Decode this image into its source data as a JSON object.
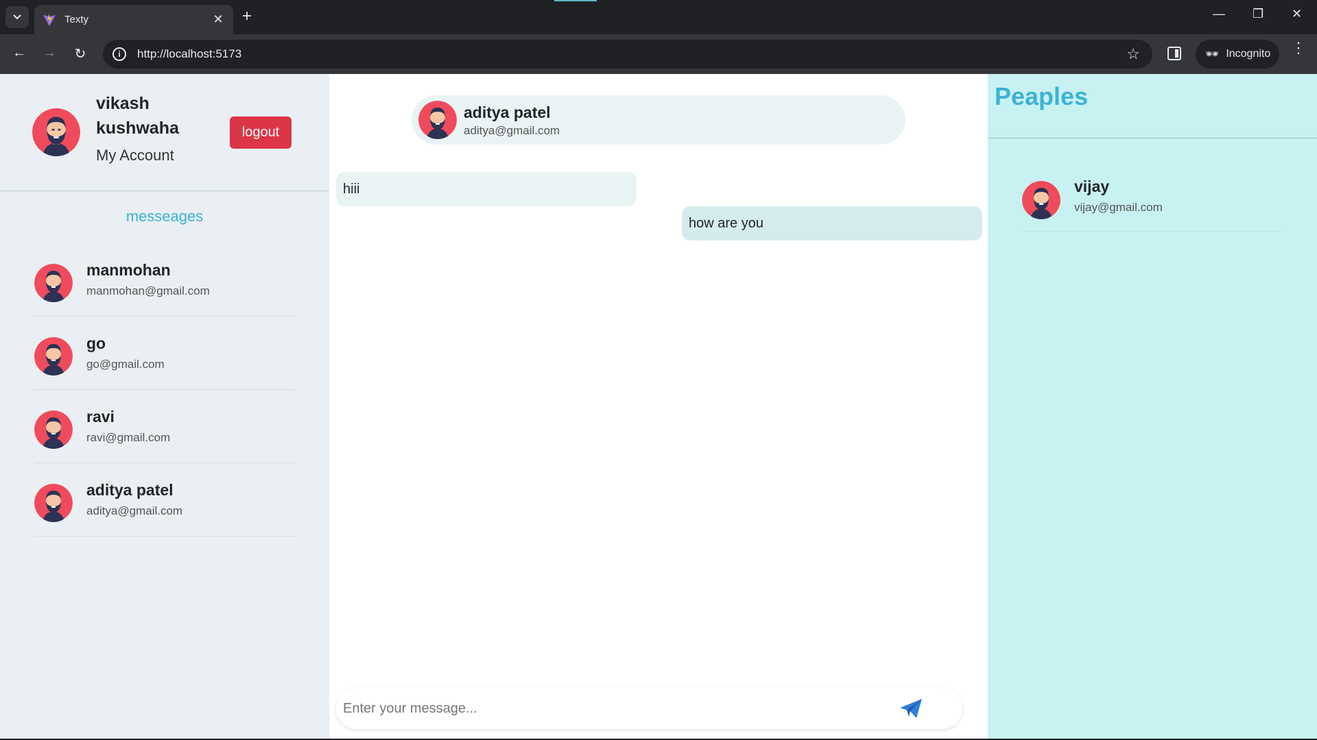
{
  "browser": {
    "tab_title": "Texty",
    "url": "http://localhost:5173",
    "incognito_label": "Incognito"
  },
  "me": {
    "name": "vikash kushwaha",
    "account_label": "My Account",
    "logout_label": "logout"
  },
  "sidebar": {
    "title": "messeages",
    "contacts": [
      {
        "name": "manmohan",
        "email": "manmohan@gmail.com"
      },
      {
        "name": "go",
        "email": "go@gmail.com"
      },
      {
        "name": "ravi",
        "email": "ravi@gmail.com"
      },
      {
        "name": "aditya patel",
        "email": "aditya@gmail.com"
      }
    ]
  },
  "chat": {
    "header": {
      "name": "aditya patel",
      "email": "aditya@gmail.com"
    },
    "messages": [
      {
        "text": "hiii",
        "direction": "incoming"
      },
      {
        "text": "how are you",
        "direction": "outgoing"
      }
    ],
    "input_placeholder": "Enter your message..."
  },
  "peoples": {
    "title": "Peaples",
    "people": [
      {
        "name": "vijay",
        "email": "vijay@gmail.com"
      }
    ]
  },
  "colors": {
    "accent": "#3cb3d5",
    "logout": "#dc3545",
    "send": "#2f7fd8"
  }
}
